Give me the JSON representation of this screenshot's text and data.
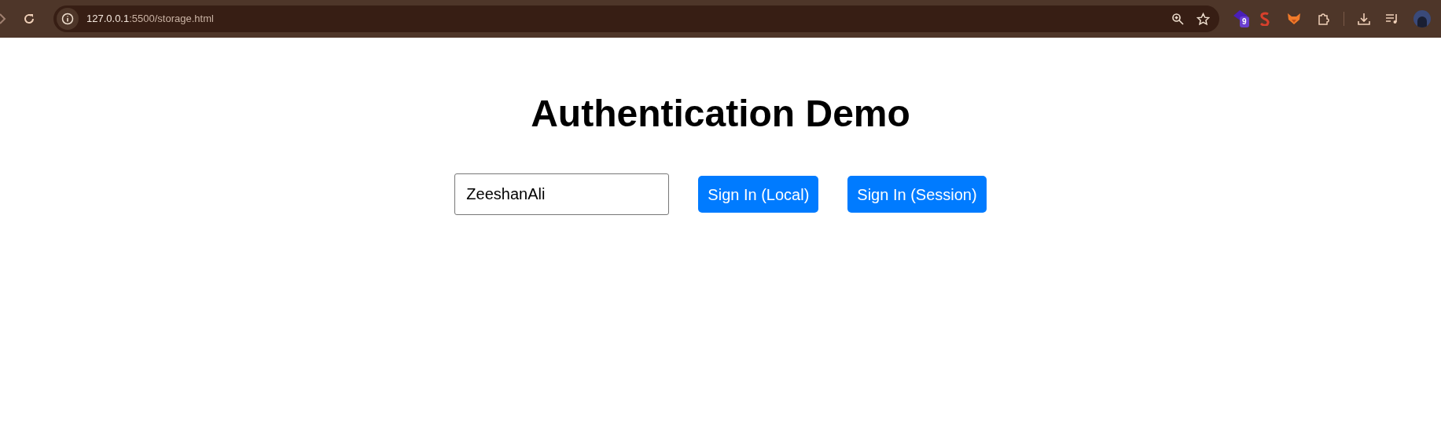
{
  "browser": {
    "url_host": "127.0.0.1",
    "url_rest": ":5500/storage.html",
    "extension_badge": "9"
  },
  "page": {
    "title": "Authentication Demo",
    "username": {
      "value": "ZeeshanAli"
    },
    "buttons": [
      "Sign In (Local)",
      "Sign In (Session)"
    ]
  }
}
